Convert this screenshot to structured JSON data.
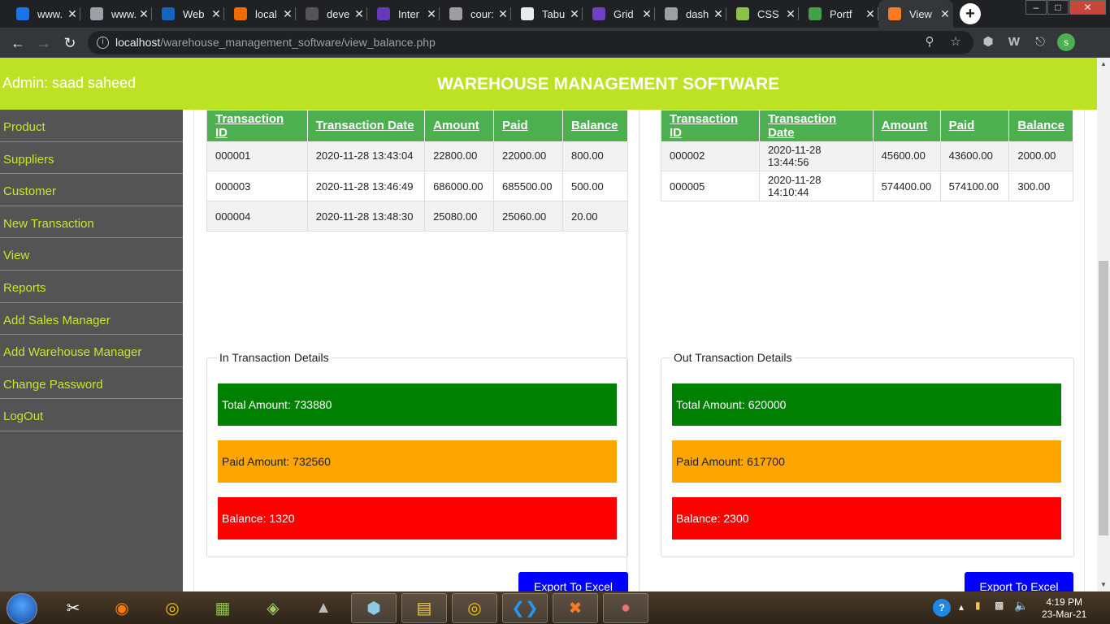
{
  "browser": {
    "tabs": [
      {
        "title": "www.",
        "icon": "video-icon",
        "color": "#1a73e8"
      },
      {
        "title": "www.",
        "icon": "c-icon",
        "color": "#9aa0a6"
      },
      {
        "title": "Web",
        "icon": "c-icon",
        "color": "#1565c0"
      },
      {
        "title": "local",
        "icon": "tool-icon",
        "color": "#ef6c00"
      },
      {
        "title": "deve",
        "icon": "cap-icon",
        "color": "#555555"
      },
      {
        "title": "Inter",
        "icon": "list-icon",
        "color": "#673ab7"
      },
      {
        "title": "cour:",
        "icon": "page-icon",
        "color": "#9e9e9e"
      },
      {
        "title": "Tabu",
        "icon": "globe-icon",
        "color": "#e8eaed"
      },
      {
        "title": "Grid",
        "icon": "b-icon",
        "color": "#6f42c1"
      },
      {
        "title": "dash",
        "icon": "doc-icon",
        "color": "#9aa0a6"
      },
      {
        "title": "CSS",
        "icon": "css-icon",
        "color": "#8bc34a"
      },
      {
        "title": "Portf",
        "icon": "portfolio-icon",
        "color": "#43a047"
      },
      {
        "title": "View",
        "icon": "xampp-icon",
        "color": "#fb7a24",
        "active": true
      }
    ],
    "url_host": "localhost",
    "url_path": "/warehouse_management_software/view_balance.php",
    "profile_initial": "s"
  },
  "header": {
    "admin_label": "Admin: saad saheed",
    "title": "WAREHOUSE MANAGEMENT SOFTWARE"
  },
  "sidebar": {
    "items": [
      {
        "label": "Product"
      },
      {
        "label": "Suppliers"
      },
      {
        "label": "Customer"
      },
      {
        "label": "New Transaction"
      },
      {
        "label": "View"
      },
      {
        "label": "Reports"
      },
      {
        "label": "Add Sales Manager"
      },
      {
        "label": "Add Warehouse Manager"
      },
      {
        "label": "Change Password"
      },
      {
        "label": "LogOut"
      }
    ]
  },
  "in_table": {
    "headers": [
      "Transaction ID",
      "Transaction Date",
      "Amount",
      "Paid",
      "Balance"
    ],
    "rows": [
      [
        "000001",
        "2020-11-28 13:43:04",
        "22800.00",
        "22000.00",
        "800.00"
      ],
      [
        "000003",
        "2020-11-28 13:46:49",
        "686000.00",
        "685500.00",
        "500.00"
      ],
      [
        "000004",
        "2020-11-28 13:48:30",
        "25080.00",
        "25060.00",
        "20.00"
      ]
    ]
  },
  "out_table": {
    "headers": [
      "Transaction ID",
      "Transaction Date",
      "Amount",
      "Paid",
      "Balance"
    ],
    "rows": [
      [
        "000002",
        "2020-11-28 13:44:56",
        "45600.00",
        "43600.00",
        "2000.00"
      ],
      [
        "000005",
        "2020-11-28 14:10:44",
        "574400.00",
        "574100.00",
        "300.00"
      ]
    ]
  },
  "in_details": {
    "legend": "In Transaction Details",
    "total": "Total Amount: 733880",
    "paid": "Paid Amount: 732560",
    "balance": "Balance: 1320",
    "export_label": "Export To Excel"
  },
  "out_details": {
    "legend": "Out Transaction Details",
    "total": "Total Amount: 620000",
    "paid": "Paid Amount: 617700",
    "balance": "Balance: 2300",
    "export_label": "Export To Excel"
  },
  "taskbar": {
    "time": "4:19 PM",
    "date": "23-Mar-21"
  },
  "colors": {
    "header": "#bde124",
    "sidebar": "#545454",
    "nav_text": "#c9e52a",
    "table_header": "#4caf50",
    "total": "#008000",
    "paid": "#ffa500",
    "balance": "#ff0000",
    "export": "#0000ff"
  }
}
